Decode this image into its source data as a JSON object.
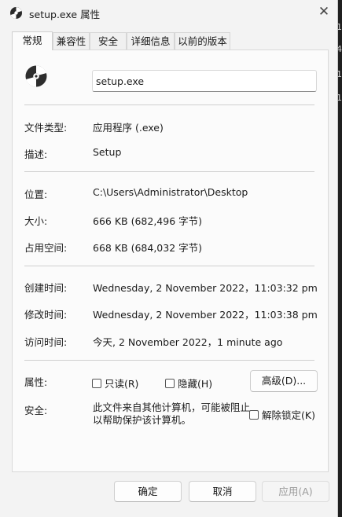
{
  "window": {
    "title": "setup.exe 属性",
    "close_glyph": "✕"
  },
  "tabs": [
    {
      "label": "常规",
      "active": true
    },
    {
      "label": "兼容性"
    },
    {
      "label": "安全"
    },
    {
      "label": "详细信息"
    },
    {
      "label": "以前的版本"
    }
  ],
  "file": {
    "name": "setup.exe",
    "icon": "disc-setup-icon"
  },
  "props": {
    "type_label": "文件类型:",
    "type_value": "应用程序 (.exe)",
    "desc_label": "描述:",
    "desc_value": "Setup",
    "location_label": "位置:",
    "location_value": "C:\\Users\\Administrator\\Desktop",
    "size_label": "大小:",
    "size_value": "666 KB (682,496 字节)",
    "disk_label": "占用空间:",
    "disk_value": "668 KB (684,032 字节)",
    "created_label": "创建时间:",
    "created_value": "Wednesday, 2 November 2022，11:03:32 pm",
    "modified_label": "修改时间:",
    "modified_value": "Wednesday, 2 November 2022，11:03:38 pm",
    "accessed_label": "访问时间:",
    "accessed_value": "今天, 2 November 2022，1 minute ago"
  },
  "attributes": {
    "label": "属性:",
    "readonly": "只读(R)",
    "hidden": "隐藏(H)",
    "advanced": "高级(D)..."
  },
  "security": {
    "label": "安全:",
    "text_line1": "此文件来自其他计算机，可能被阻止",
    "text_line2": "以帮助保护该计算机。",
    "unblock": "解除锁定(K)"
  },
  "buttons": {
    "ok": "确定",
    "cancel": "取消",
    "apply": "应用(A)"
  },
  "background_edge": [
    "1",
    "4",
    "1",
    "1"
  ]
}
